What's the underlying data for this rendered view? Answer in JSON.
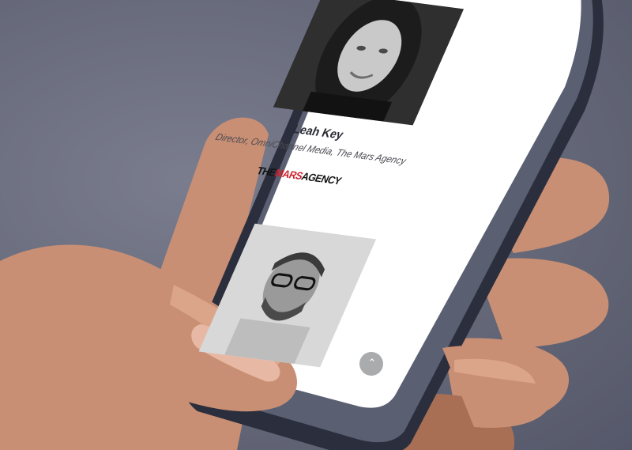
{
  "speakers": [
    {
      "name": "Leah Key",
      "title": "Director, OmniChannel Media, The Mars Agency",
      "company_logo": {
        "part1": "THE",
        "part2": "MARS",
        "part3": "AGENCY",
        "accent_color": "#d0202b"
      }
    },
    {
      "name": "",
      "title": ""
    }
  ],
  "scroll_top_icon": "chevron-up-icon",
  "colors": {
    "background": "#656878",
    "screen": "#ffffff",
    "phone_frame": "#2b2f3d",
    "skin": "#c98f74"
  }
}
